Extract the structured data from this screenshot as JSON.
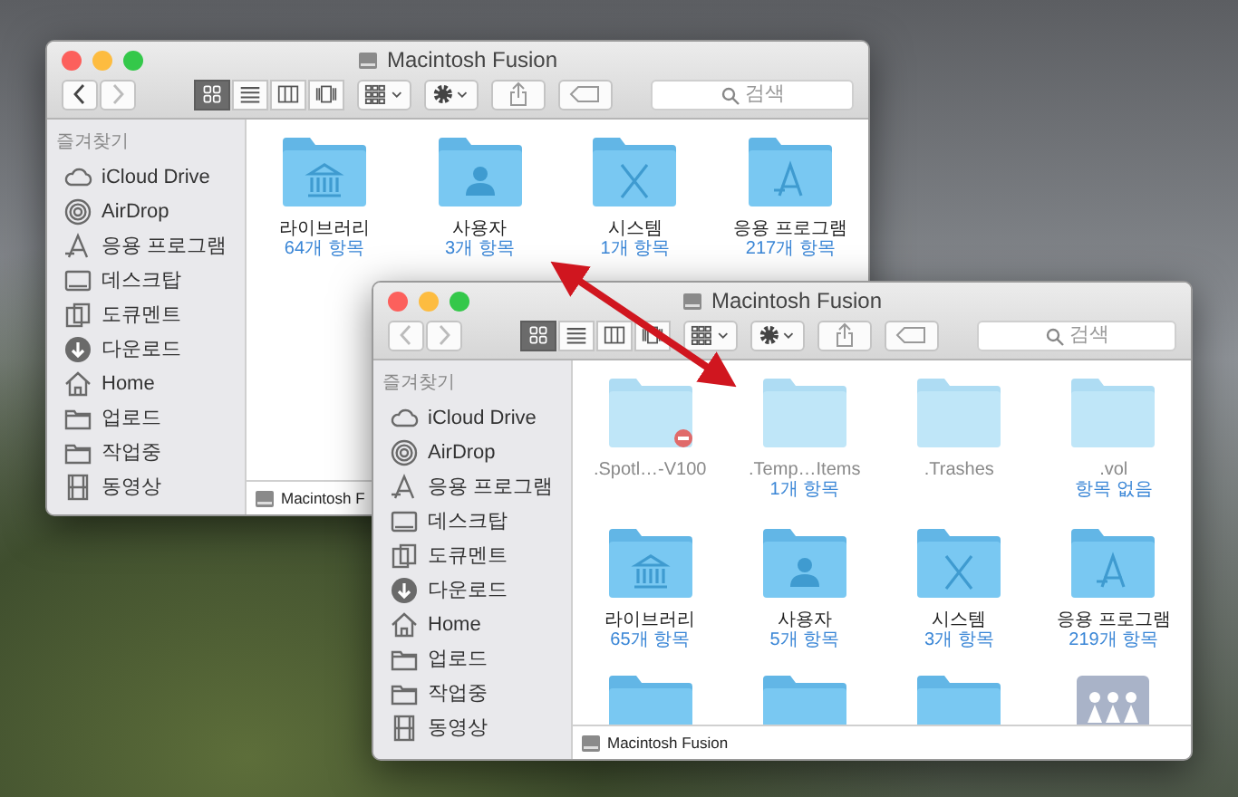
{
  "windows": [
    {
      "title": "Macintosh Fusion",
      "back_enabled": true,
      "views": [
        {
          "selected": true
        },
        {
          "selected": false
        },
        {
          "selected": false
        },
        {
          "selected": false
        }
      ],
      "search": {
        "placeholder": "검색"
      },
      "sidebar": {
        "heading": "즐겨찾기",
        "items": [
          {
            "label": "iCloud Drive",
            "kind": "cloud"
          },
          {
            "label": "AirDrop",
            "kind": "airdrop"
          },
          {
            "label": "응용 프로그램",
            "kind": "apps"
          },
          {
            "label": "데스크탑",
            "kind": "desktop"
          },
          {
            "label": "도큐멘트",
            "kind": "documents"
          },
          {
            "label": "다운로드",
            "kind": "download"
          },
          {
            "label": "Home",
            "kind": "home"
          },
          {
            "label": "업로드",
            "kind": "folder"
          },
          {
            "label": "작업중",
            "kind": "folder"
          },
          {
            "label": "동영상",
            "kind": "movie"
          }
        ]
      },
      "files": [
        {
          "name": "라이브러리",
          "count": "64개 항목",
          "kind": "library",
          "hidden": false
        },
        {
          "name": "사용자",
          "count": "3개 항목",
          "kind": "users",
          "hidden": false
        },
        {
          "name": "시스템",
          "count": "1개 항목",
          "kind": "system",
          "hidden": false
        },
        {
          "name": "응용 프로그램",
          "count": "217개 항목",
          "kind": "apps",
          "hidden": false
        }
      ],
      "path_bar": "Macintosh F"
    },
    {
      "title": "Macintosh Fusion",
      "back_enabled": false,
      "views": [
        {
          "selected": true
        },
        {
          "selected": false
        },
        {
          "selected": false
        },
        {
          "selected": false
        }
      ],
      "search": {
        "placeholder": "검색"
      },
      "sidebar": {
        "heading": "즐겨찾기",
        "items": [
          {
            "label": "iCloud Drive",
            "kind": "cloud"
          },
          {
            "label": "AirDrop",
            "kind": "airdrop"
          },
          {
            "label": "응용 프로그램",
            "kind": "apps"
          },
          {
            "label": "데스크탑",
            "kind": "desktop"
          },
          {
            "label": "도큐멘트",
            "kind": "documents"
          },
          {
            "label": "다운로드",
            "kind": "download"
          },
          {
            "label": "Home",
            "kind": "home"
          },
          {
            "label": "업로드",
            "kind": "folder"
          },
          {
            "label": "작업중",
            "kind": "folder"
          },
          {
            "label": "동영상",
            "kind": "movie"
          }
        ]
      },
      "files": [
        {
          "name": ".Spotl…-V100",
          "kind": "plain",
          "hidden": true,
          "no_entry": true
        },
        {
          "name": ".Temp…Items",
          "count": "1개 항목",
          "kind": "plain",
          "hidden": true
        },
        {
          "name": ".Trashes",
          "kind": "plain",
          "hidden": true
        },
        {
          "name": ".vol",
          "count": "항목 없음",
          "kind": "plain",
          "hidden": true
        },
        {
          "name": "라이브러리",
          "count": "65개 항목",
          "kind": "library",
          "hidden": false
        },
        {
          "name": "사용자",
          "count": "5개 항목",
          "kind": "users",
          "hidden": false
        },
        {
          "name": "시스템",
          "count": "3개 항목",
          "kind": "system",
          "hidden": false
        },
        {
          "name": "응용 프로그램",
          "count": "219개 항목",
          "kind": "apps",
          "hidden": false
        }
      ],
      "partial_row": [
        {
          "kind": "folder"
        },
        {
          "kind": "folder"
        },
        {
          "kind": "folder"
        },
        {
          "kind": "shared"
        }
      ],
      "path_bar": "Macintosh Fusion"
    }
  ]
}
